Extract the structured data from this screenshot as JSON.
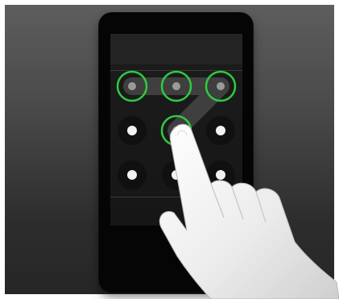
{
  "screen": {
    "type": "pattern-lock",
    "grid_size": [
      3,
      3
    ],
    "pattern_sequence": [
      1,
      2,
      3,
      5
    ],
    "selected_nodes": [
      1,
      2,
      3,
      5
    ],
    "node_selected_color": "#2ecc40",
    "trace_color": "#3f3f3f",
    "node_dot_color": "#f2f2f2",
    "background_color": "#1a1a1a"
  },
  "overlay": {
    "hand_icon": "pointing-hand-icon"
  }
}
